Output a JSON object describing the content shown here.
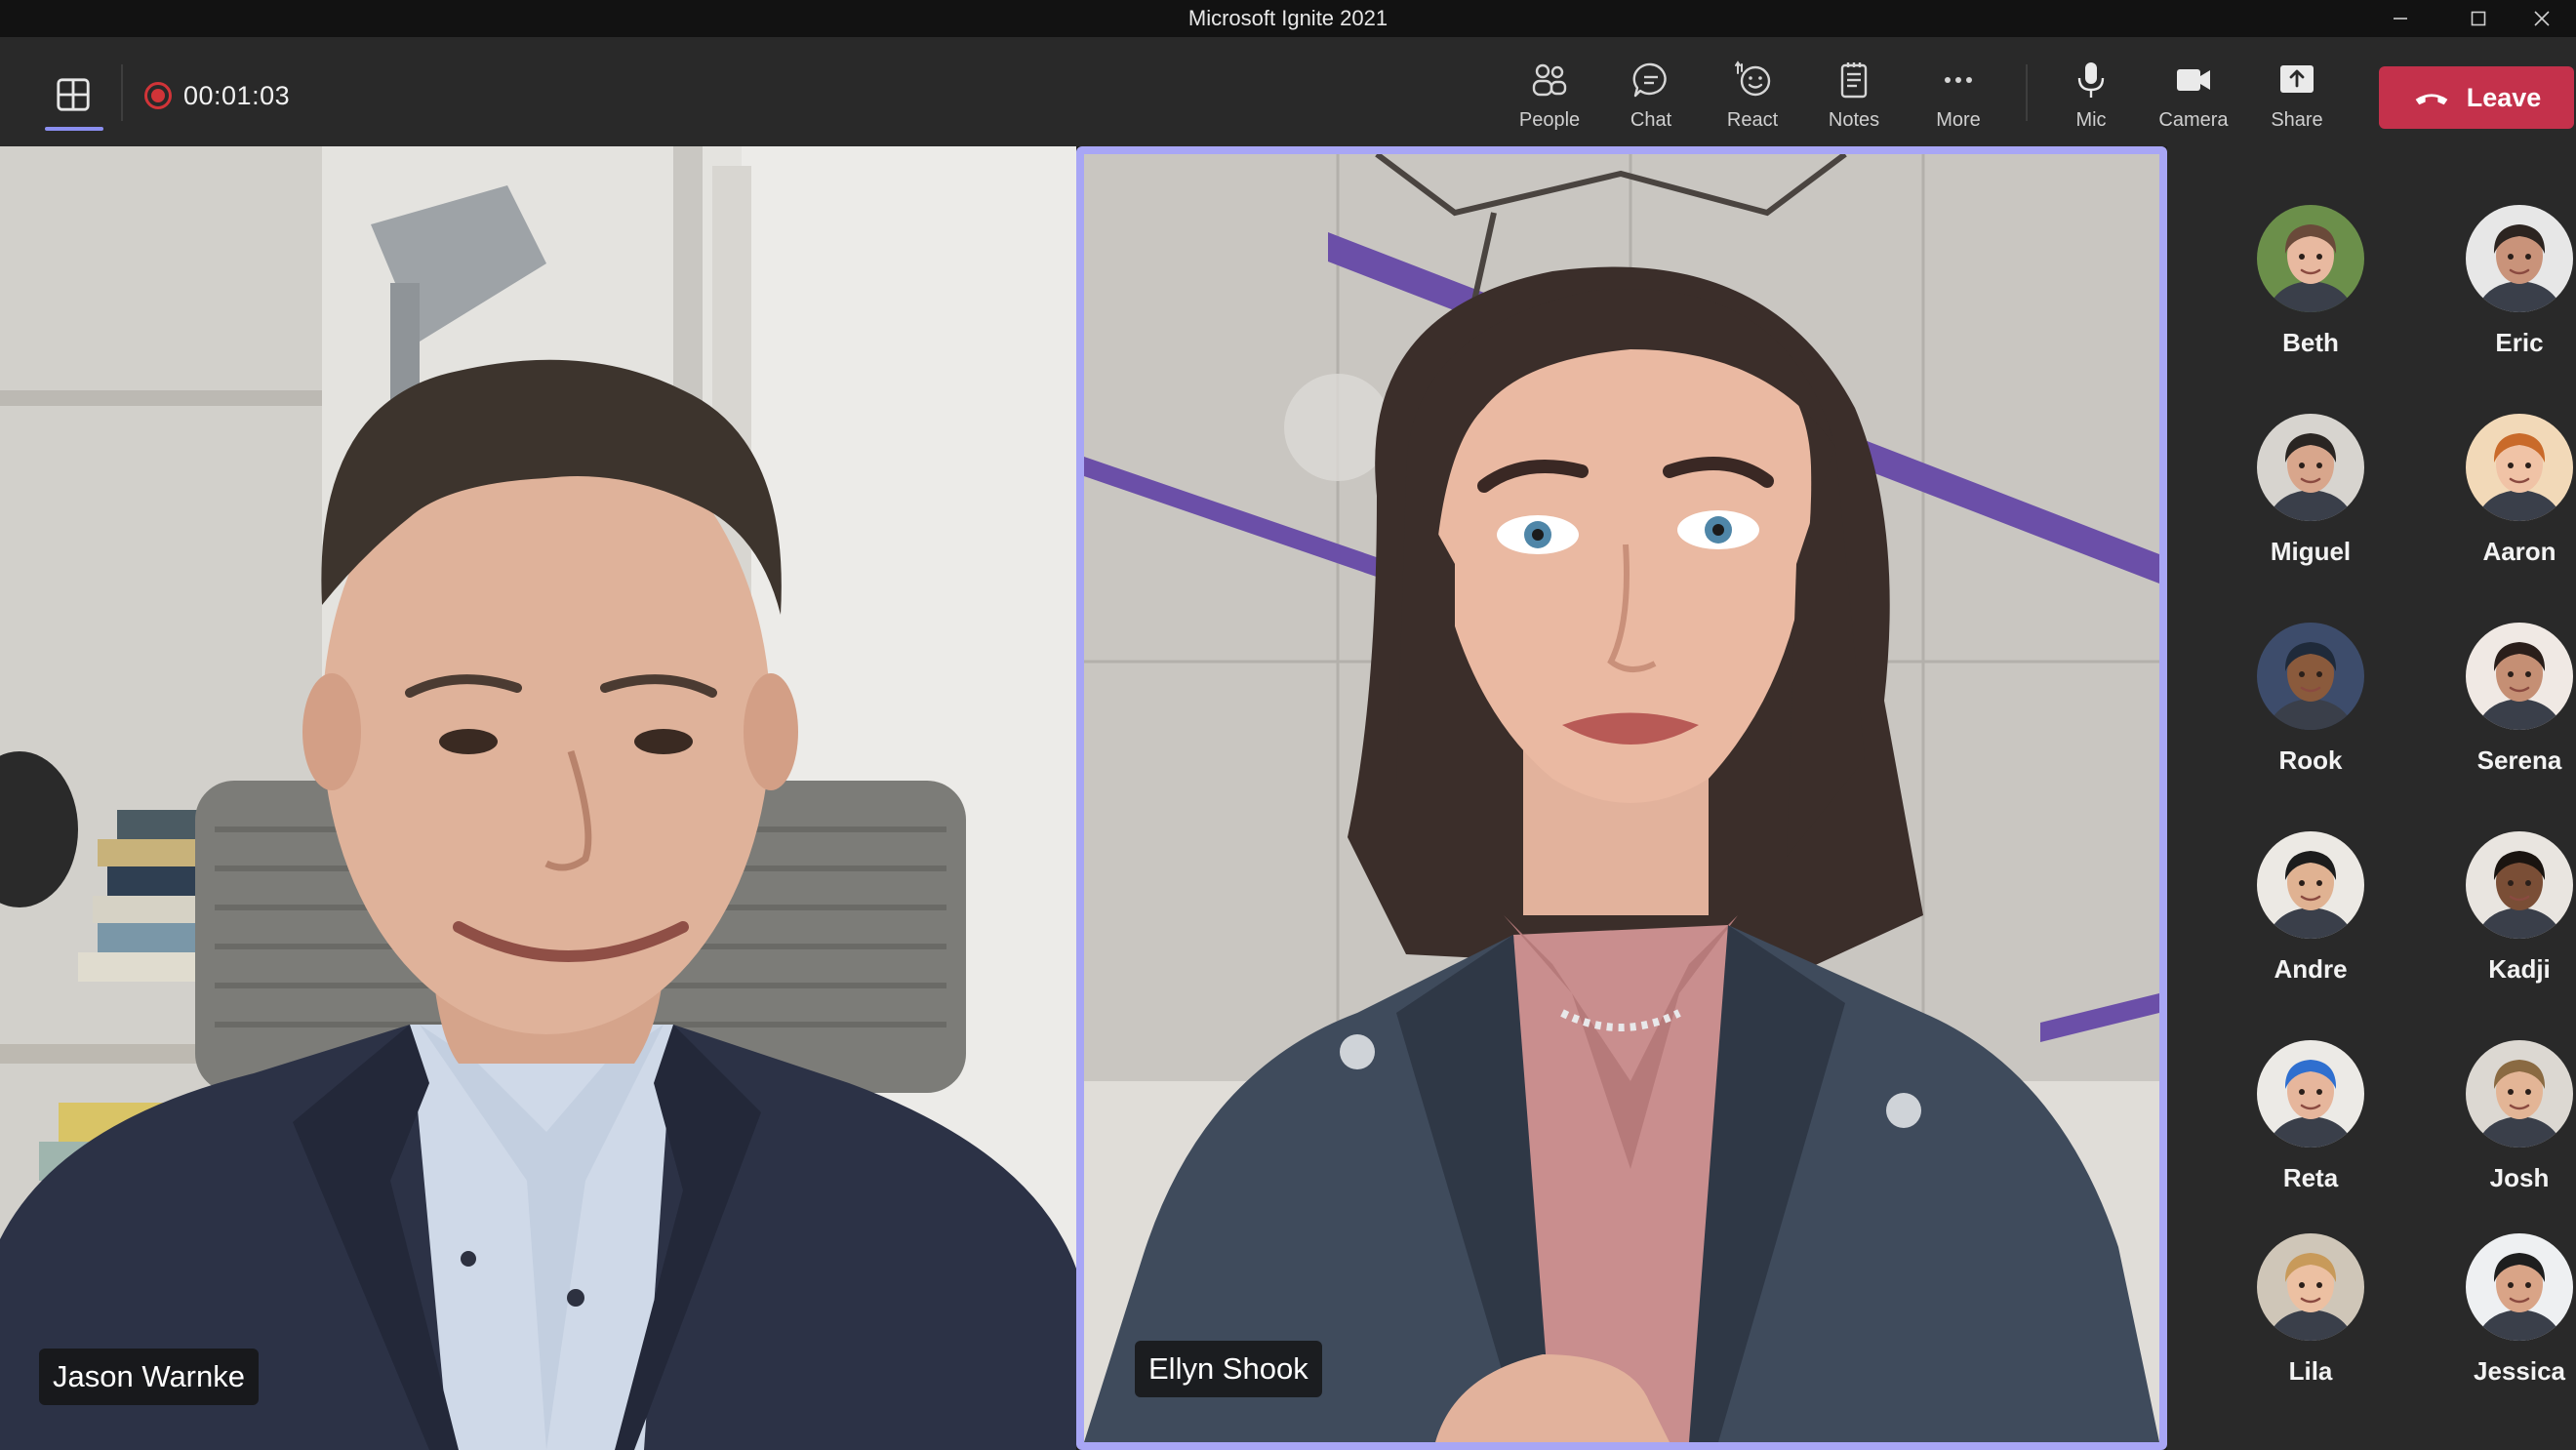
{
  "window": {
    "title": "Microsoft Ignite 2021"
  },
  "toolbar": {
    "recording_time": "00:01:03",
    "people_label": "People",
    "chat_label": "Chat",
    "react_label": "React",
    "notes_label": "Notes",
    "more_label": "More",
    "mic_label": "Mic",
    "camera_label": "Camera",
    "share_label": "Share",
    "leave_label": "Leave",
    "leave_color": "#c4314b",
    "active_accent": "#8b8ff0"
  },
  "stage": {
    "left_participant": "Jason Warnke",
    "right_participant": "Ellyn Shook",
    "spotlight_border_color": "#a8a6f5"
  },
  "participants": [
    {
      "name": "Beth"
    },
    {
      "name": "Eric"
    },
    {
      "name": "Miguel"
    },
    {
      "name": "Aaron"
    },
    {
      "name": "Rook"
    },
    {
      "name": "Serena"
    },
    {
      "name": "Andre"
    },
    {
      "name": "Kadji"
    },
    {
      "name": "Reta"
    },
    {
      "name": "Josh"
    },
    {
      "name": "Lila"
    },
    {
      "name": "Jessica"
    }
  ]
}
